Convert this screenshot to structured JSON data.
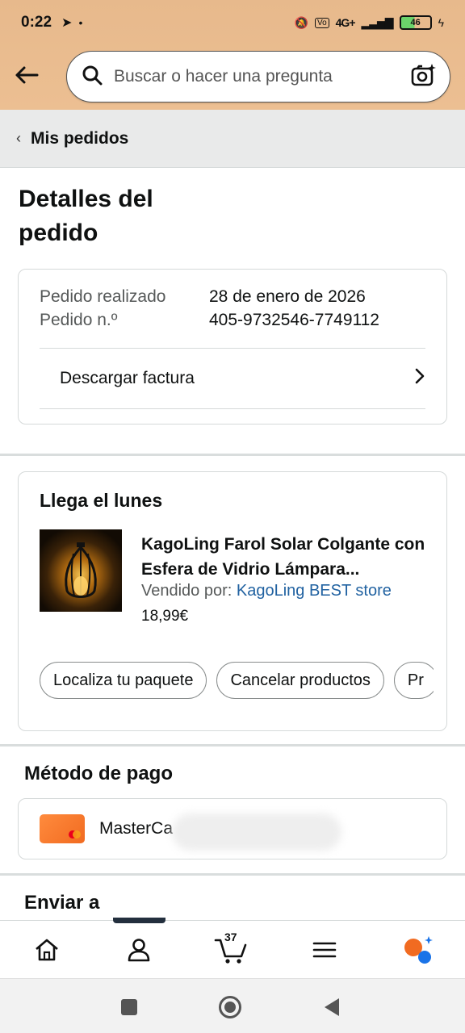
{
  "status_bar": {
    "time": "0:22",
    "network": "4G+",
    "battery": "46"
  },
  "header": {
    "search_placeholder": "Buscar o hacer una pregunta"
  },
  "breadcrumb": {
    "label": "Mis pedidos"
  },
  "page": {
    "title_line1": "Detalles del",
    "title_line2": "pedido"
  },
  "order_info": {
    "placed_label": "Pedido realizado",
    "placed_value": "28 de enero de 2026",
    "number_label": "Pedido n.º",
    "number_value": "405-9732546-7749112",
    "download_invoice": "Descargar factura"
  },
  "shipment": {
    "heading": "Llega el lunes",
    "product_name": "KagoLing Farol Solar Colgante con Esfera de Vidrio Lámpara...",
    "sold_by_label": "Vendido por:",
    "seller": "KagoLing BEST store",
    "price": "18,99€",
    "actions": [
      "Localiza tu paquete",
      "Cancelar productos",
      "Pr"
    ]
  },
  "payment": {
    "heading": "Método de pago",
    "card_name": "MasterCa"
  },
  "ship_to": {
    "heading": "Enviar a"
  },
  "bottom_nav": {
    "cart_count": "37",
    "active": "account"
  },
  "colors": {
    "header_bg": "#ecbf92",
    "link": "#2162a1",
    "nav_indicator": "#232f3e",
    "card_orange": "#f16b21"
  }
}
